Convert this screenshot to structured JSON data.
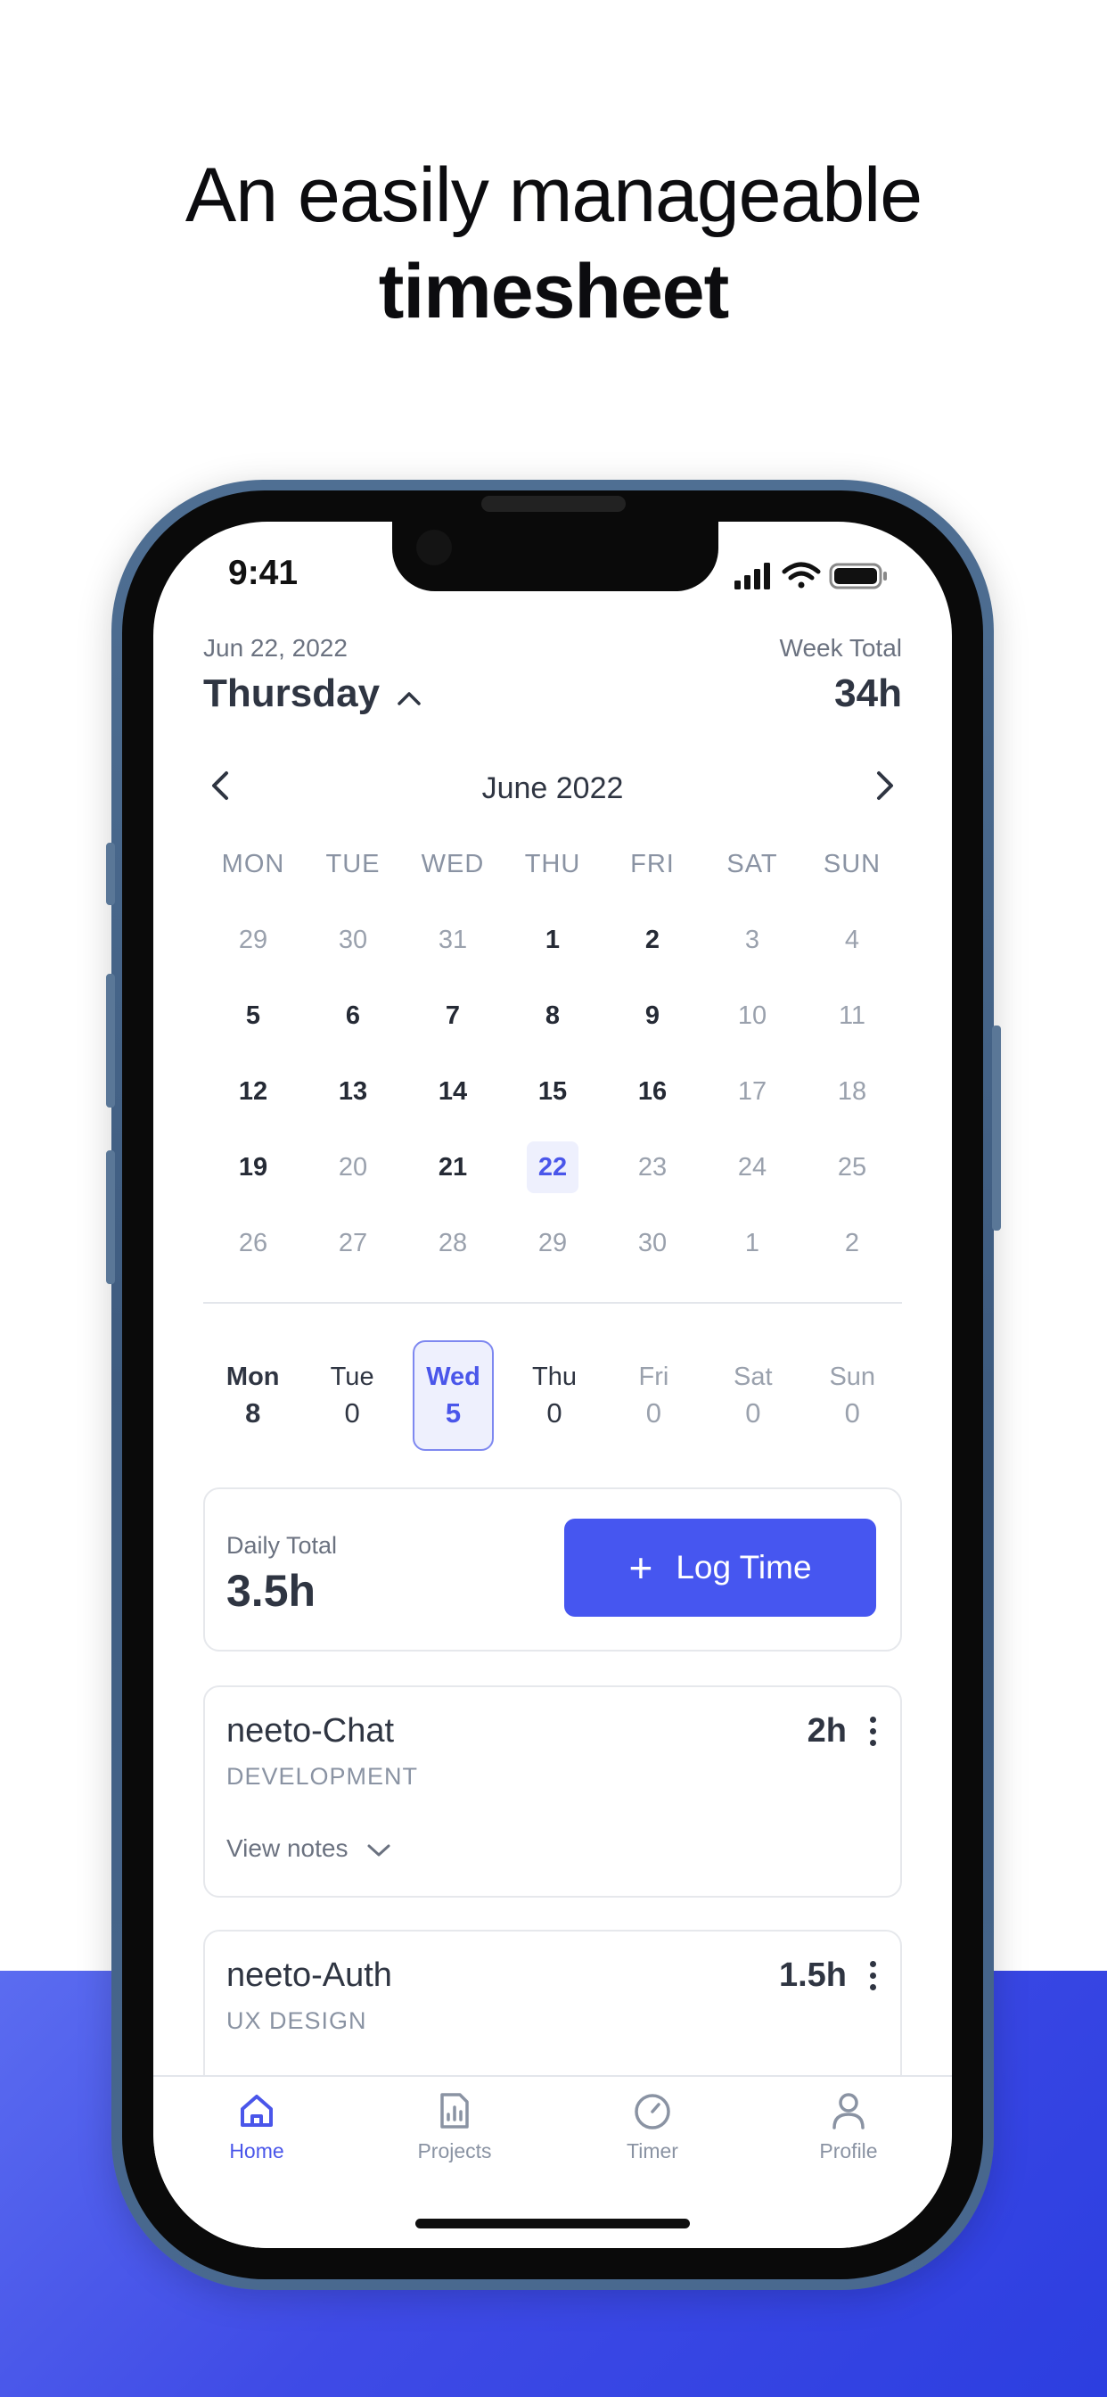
{
  "headline": {
    "line1": "An easily manageable",
    "line2": "timesheet"
  },
  "status_bar": {
    "time": "9:41"
  },
  "header": {
    "date": "Jun 22, 2022",
    "weekday": "Thursday",
    "week_total_label": "Week Total",
    "week_total_value": "34h"
  },
  "calendar": {
    "month_label": "June 2022",
    "day_headers": [
      "MON",
      "TUE",
      "WED",
      "THU",
      "FRI",
      "SAT",
      "SUN"
    ],
    "weeks": [
      [
        {
          "d": "29",
          "s": "muted"
        },
        {
          "d": "30",
          "s": "muted"
        },
        {
          "d": "31",
          "s": "muted"
        },
        {
          "d": "1",
          "s": "bold"
        },
        {
          "d": "2",
          "s": "bold"
        },
        {
          "d": "3",
          "s": "muted"
        },
        {
          "d": "4",
          "s": "muted"
        }
      ],
      [
        {
          "d": "5",
          "s": "bold"
        },
        {
          "d": "6",
          "s": "bold"
        },
        {
          "d": "7",
          "s": "bold"
        },
        {
          "d": "8",
          "s": "bold"
        },
        {
          "d": "9",
          "s": "bold"
        },
        {
          "d": "10",
          "s": "muted"
        },
        {
          "d": "11",
          "s": "muted"
        }
      ],
      [
        {
          "d": "12",
          "s": "bold"
        },
        {
          "d": "13",
          "s": "bold"
        },
        {
          "d": "14",
          "s": "bold"
        },
        {
          "d": "15",
          "s": "bold"
        },
        {
          "d": "16",
          "s": "bold"
        },
        {
          "d": "17",
          "s": "muted"
        },
        {
          "d": "18",
          "s": "muted"
        }
      ],
      [
        {
          "d": "19",
          "s": "bold"
        },
        {
          "d": "20",
          "s": "normal"
        },
        {
          "d": "21",
          "s": "bold"
        },
        {
          "d": "22",
          "s": "today"
        },
        {
          "d": "23",
          "s": "muted"
        },
        {
          "d": "24",
          "s": "muted"
        },
        {
          "d": "25",
          "s": "muted"
        }
      ],
      [
        {
          "d": "26",
          "s": "muted"
        },
        {
          "d": "27",
          "s": "muted"
        },
        {
          "d": "28",
          "s": "muted"
        },
        {
          "d": "29",
          "s": "muted"
        },
        {
          "d": "30",
          "s": "muted"
        },
        {
          "d": "1",
          "s": "muted"
        },
        {
          "d": "2",
          "s": "muted"
        }
      ]
    ]
  },
  "week_strip": [
    {
      "name": "Mon",
      "value": "8",
      "state": "strong"
    },
    {
      "name": "Tue",
      "value": "0",
      "state": "normal"
    },
    {
      "name": "Wed",
      "value": "5",
      "state": "sel"
    },
    {
      "name": "Thu",
      "value": "0",
      "state": "normal"
    },
    {
      "name": "Fri",
      "value": "0",
      "state": "dim"
    },
    {
      "name": "Sat",
      "value": "0",
      "state": "dim"
    },
    {
      "name": "Sun",
      "value": "0",
      "state": "dim"
    }
  ],
  "daily": {
    "label": "Daily Total",
    "value": "3.5h",
    "log_button": "Log Time"
  },
  "entries": [
    {
      "title": "neeto-Chat",
      "category": "DEVELOPMENT",
      "hours": "2h",
      "notes_label": "View notes"
    },
    {
      "title": "neeto-Auth",
      "category": "UX DESIGN",
      "hours": "1.5h"
    }
  ],
  "tabs": [
    {
      "label": "Home",
      "icon": "home-icon",
      "active": true
    },
    {
      "label": "Projects",
      "icon": "projects-icon",
      "active": false
    },
    {
      "label": "Timer",
      "icon": "timer-icon",
      "active": false
    },
    {
      "label": "Profile",
      "icon": "profile-icon",
      "active": false
    }
  ],
  "colors": {
    "accent": "#4656f0",
    "band": "#3f4be6",
    "frame": "#4f6f93"
  }
}
